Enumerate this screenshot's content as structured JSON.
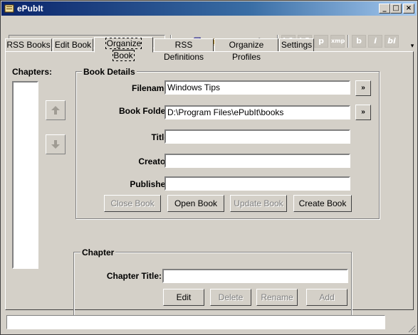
{
  "window": {
    "title": "ePubIt"
  },
  "titlebar_buttons": {
    "minimize": "_",
    "maximize": "□",
    "close": "×"
  },
  "toolbar": {
    "combo_value": "",
    "buttons": [
      {
        "name": "cut-icon",
        "glyph": "✂"
      },
      {
        "name": "copy-icon",
        "glyph": "⧉"
      },
      {
        "name": "paste-icon",
        "glyph": "📋"
      },
      {
        "name": "undo-icon",
        "glyph": "↶"
      },
      {
        "name": "redo-icon",
        "glyph": "↷"
      },
      {
        "name": "highlight-icon",
        "glyph": "✎"
      }
    ],
    "format_buttons": [
      "h1",
      "h2",
      "p",
      "xmp",
      "b",
      "i",
      "bi"
    ]
  },
  "tabs": [
    {
      "label": "RSS Books",
      "active": false
    },
    {
      "label": "Edit Book",
      "active": false
    },
    {
      "label": "Organize Book",
      "active": true
    },
    {
      "label": "RSS Definitions",
      "active": false
    },
    {
      "label": "Organize Profiles",
      "active": false
    },
    {
      "label": "Settings",
      "active": false
    }
  ],
  "chapters": {
    "label": "Chapters:",
    "items": []
  },
  "book_details": {
    "title": "Book Details",
    "filename_label": "Filename:",
    "filename_value": "Windows Tips",
    "folder_label": "Book Folder:",
    "folder_value": "D:\\Program Files\\ePubIt\\books",
    "title_label": "Title:",
    "title_value": "",
    "creator_label": "Creator:",
    "creator_value": "",
    "publisher_label": "Publisher:",
    "publisher_value": "",
    "browse_label": "»",
    "buttons": {
      "close": "Close Book",
      "open": "Open Book",
      "update": "Update Book",
      "create": "Create Book"
    }
  },
  "chapter": {
    "title": "Chapter",
    "chapter_title_label": "Chapter Title:",
    "chapter_title_value": "",
    "buttons": {
      "edit": "Edit",
      "delete": "Delete",
      "rename": "Rename",
      "add": "Add"
    }
  },
  "status": {
    "text": ""
  }
}
